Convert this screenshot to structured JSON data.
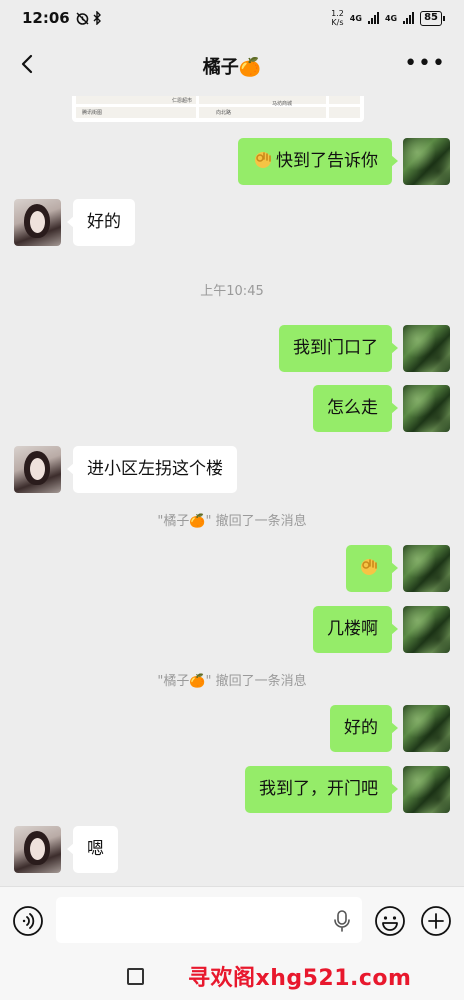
{
  "status_bar": {
    "time": "12:06",
    "net_rate_value": "1.2",
    "net_rate_unit": "K/s",
    "signal1_label": "4G",
    "signal2_label": "4G",
    "battery": "85"
  },
  "header": {
    "title": "橘子🍊",
    "back_icon": "chevron-left-icon",
    "more_icon": "more-dots-icon"
  },
  "location_card": {
    "labels": [
      "仁恩超市",
      "腾讯街图",
      "向北路",
      "马坊商城"
    ]
  },
  "messages": [
    {
      "from": "me",
      "emoji": "ok-hand",
      "text": "快到了告诉你"
    },
    {
      "from": "them",
      "text": "好的"
    },
    {
      "type": "time",
      "text": "上午10:45"
    },
    {
      "from": "me",
      "text": "我到门口了"
    },
    {
      "from": "me",
      "text": "怎么走"
    },
    {
      "from": "them",
      "text": "进小区左拐这个楼"
    },
    {
      "type": "system",
      "text": "\"橘子🍊\" 撤回了一条消息"
    },
    {
      "from": "me",
      "emoji": "ok-hand",
      "text": ""
    },
    {
      "from": "me",
      "text": "几楼啊"
    },
    {
      "type": "system",
      "text": "\"橘子🍊\" 撤回了一条消息"
    },
    {
      "from": "me",
      "text": "好的"
    },
    {
      "from": "me",
      "text": "我到了，开门吧"
    },
    {
      "from": "them",
      "text": "嗯"
    }
  ],
  "input_bar": {
    "voice_icon": "voice-icon",
    "mic_icon": "mic-icon",
    "emoji_icon": "emoji-icon",
    "plus_icon": "plus-icon"
  },
  "watermark": "寻欢阁xhg521.com"
}
